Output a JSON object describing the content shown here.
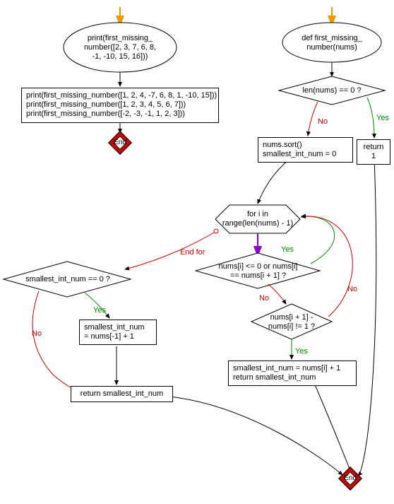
{
  "left": {
    "start": "print(first_missing_\nnumber([2, 3, 7, 6, 8,\n-1, -10, 15, 16]))",
    "calls": "print(first_missing_number([1, 2, 4, -7, 6, 8, 1, -10, 15]))\nprint(first_missing_number([1, 2, 3, 4, 5, 6, 7]))\nprint(first_missing_number([-2, -3, -1, 1, 2, 3]))",
    "end": "End"
  },
  "right": {
    "def": "def first_missing_\nnumber(nums)",
    "cond_empty": "len(nums) == 0 ?",
    "ret1": "return 1",
    "init": "nums.sort()\nsmallest_int_num = 0",
    "loop": "for i in\nrange(len(nums) - 1)",
    "end_for": "End for",
    "cond_skip": "nums[i] <= 0 or nums[i]\n== nums[i + 1] ?",
    "cond_gap": "nums[i + 1] -\nnums[i] != 1 ?",
    "gap_body": "smallest_int_num = nums[i] + 1\nreturn smallest_int_num",
    "cond_zero": "smallest_int_num == 0 ?",
    "assign_last": "smallest_int_num\n= nums[-1] + 1",
    "ret_small": "return smallest_int_num",
    "end": "End"
  },
  "labels": {
    "yes": "Yes",
    "no": "No"
  }
}
